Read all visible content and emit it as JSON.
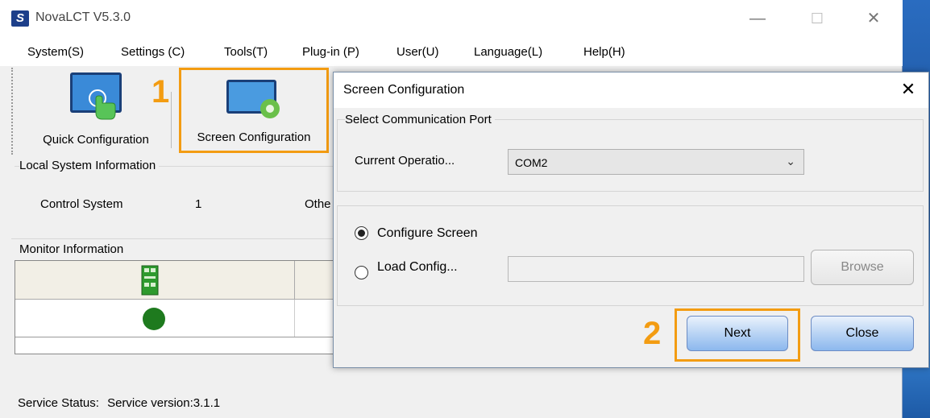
{
  "app": {
    "title": "NovaLCT V5.3.0",
    "icon": "S"
  },
  "window_controls": {
    "minimize": "—",
    "maximize": "☐",
    "close": "✕"
  },
  "menu": [
    "System(S)",
    "Settings (C)",
    "Tools(T)",
    "Plug-in (P)",
    "User(U)",
    "Language(L)",
    "Help(H)"
  ],
  "toolbar": {
    "quick_config": "Quick Configuration",
    "screen_config": "Screen Configuration",
    "step1": "1"
  },
  "local_system": {
    "title": "Local System Information",
    "control_system_label": "Control System",
    "control_system_value": "1",
    "other_label": "Othe"
  },
  "monitor": {
    "title": "Monitor Information"
  },
  "status": {
    "label": "Service Status:",
    "value": "Service version:3.1.1"
  },
  "dialog": {
    "title": "Screen Configuration",
    "close": "✕",
    "port_group_title": "Select Communication Port",
    "current_operation_label": "Current Operatio...",
    "current_operation_value": "COM2",
    "configure_screen_label": "Configure Screen",
    "load_config_label": "Load Config...",
    "load_config_path": "",
    "browse_label": "Browse",
    "next_label": "Next",
    "close_label": "Close",
    "step2": "2"
  },
  "colors": {
    "highlight": "#f39c12",
    "status_green": "#1e7a1e"
  }
}
